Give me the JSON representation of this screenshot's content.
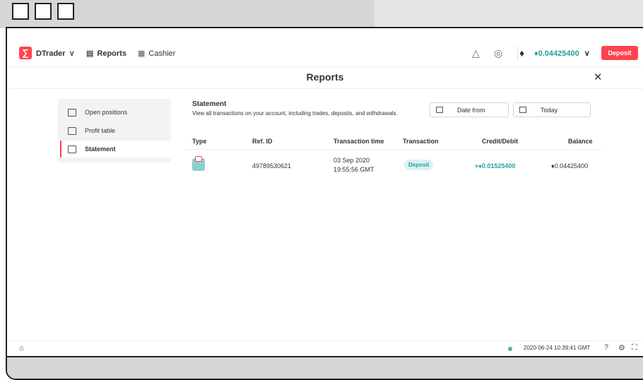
{
  "header": {
    "logo_glyph": "∑",
    "app_name": "DTrader",
    "app_chevron": "∨",
    "reports_label": "Reports",
    "cashier_label": "Cashier",
    "balance": "♦0.04425400",
    "balance_chevron": "∨",
    "deposit_label": "Deposit"
  },
  "titlebar": {
    "title": "Reports",
    "close": "✕"
  },
  "sidebar": {
    "items": [
      {
        "label": "Open positions",
        "icon": "open-positions-icon"
      },
      {
        "label": "Profit table",
        "icon": "profit-table-icon"
      },
      {
        "label": "Statement",
        "icon": "statement-icon",
        "active": true
      }
    ]
  },
  "statement": {
    "title": "Statement",
    "description": "View all transactions on your account, including trades, deposits, and withdrawals.",
    "date_from": "Date from",
    "date_to": "Today"
  },
  "table": {
    "headers": {
      "type": "Type",
      "ref": "Ref. ID",
      "time": "Transaction time",
      "transaction": "Transaction",
      "credit": "Credit/Debit",
      "balance": "Balance"
    },
    "rows": [
      {
        "ref": "49789530621",
        "date": "03 Sep 2020",
        "time": "19:55:56 GMT",
        "transaction": "Deposit",
        "credit": "+♦0.01525400",
        "balance": "♦0.04425400"
      }
    ]
  },
  "footer": {
    "server_time": "2020-06-24 10:39:41 GMT"
  },
  "colors": {
    "brand": "#ff444f",
    "accent": "#21a1a1"
  }
}
